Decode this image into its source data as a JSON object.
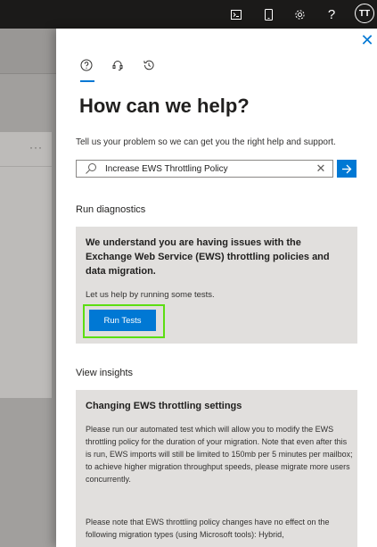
{
  "topbar": {
    "icons": [
      "terminal-icon",
      "mobile-icon",
      "gear-icon",
      "help-icon"
    ],
    "avatar_initials": "TT"
  },
  "panel": {
    "tabs": [
      "help-icon",
      "headset-icon",
      "history-icon"
    ],
    "title": "How can we help?",
    "subtitle": "Tell us your problem so we can get you the right help and support.",
    "search": {
      "value": "Increase EWS Throttling Policy"
    },
    "diagnostics": {
      "label": "Run diagnostics",
      "heading": "We understand you are having issues with the Exchange Web Service (EWS) throttling policies and data migration.",
      "subtext": "Let us help by running some tests.",
      "button_label": "Run Tests"
    },
    "insights": {
      "label": "View insights",
      "heading": "Changing EWS throttling settings",
      "paragraph1": "Please run our automated test which will allow you to modify the EWS throttling policy for the duration of your migration. Note that even after this is run, EWS imports will still be limited to 150mb per 5 minutes per mailbox; to achieve higher migration throughput speeds, please migrate more users concurrently.",
      "paragraph2": "Please note that EWS throttling policy changes have no effect on the following migration types (using Microsoft tools): Hybrid,"
    }
  },
  "colors": {
    "accent": "#0078d4",
    "highlight": "#5cde12",
    "topbar": "#1b1a19"
  }
}
